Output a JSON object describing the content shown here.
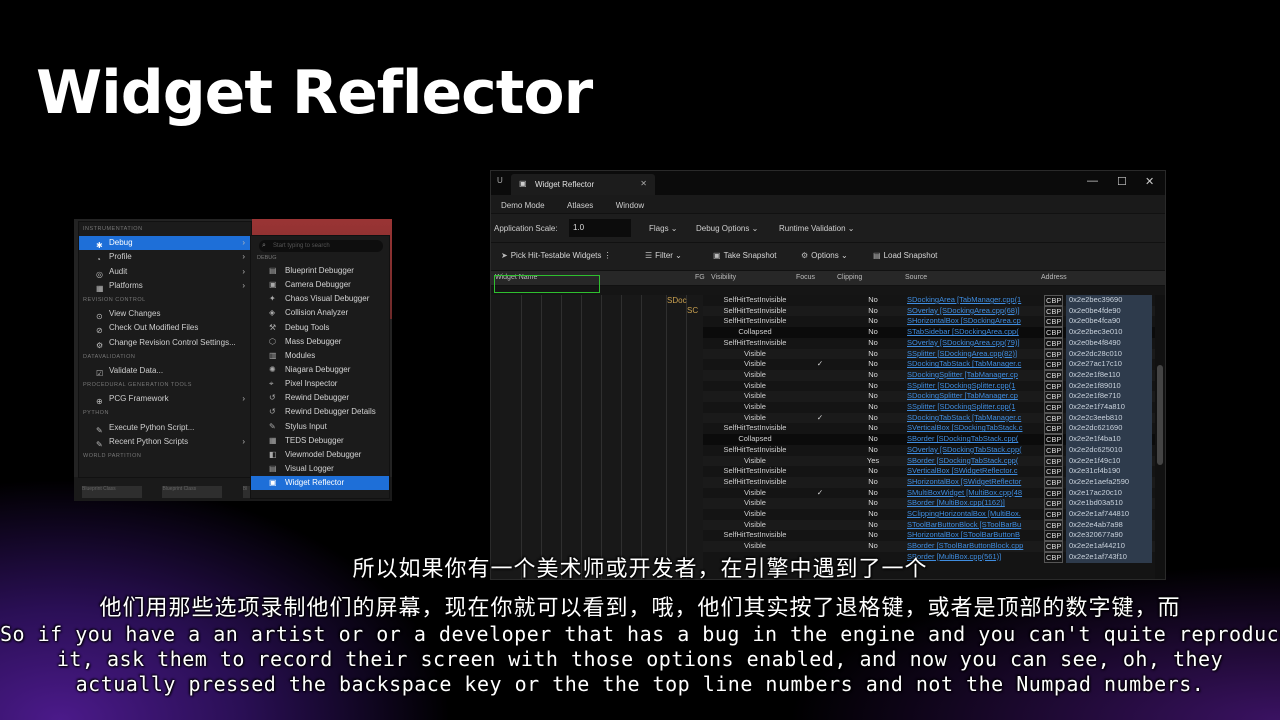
{
  "slide_title": "Widget Reflector",
  "menu": {
    "left_items": [
      {
        "type": "section",
        "label": "INSTRUMENTATION"
      },
      {
        "type": "item",
        "label": "Debug",
        "icon": "bug-icon",
        "arrow": true,
        "active": true
      },
      {
        "type": "item",
        "label": "Profile",
        "icon": "profile-icon",
        "arrow": true
      },
      {
        "type": "item",
        "label": "Audit",
        "icon": "audit-icon",
        "arrow": true
      },
      {
        "type": "item",
        "label": "Platforms",
        "icon": "platforms-icon",
        "arrow": true
      },
      {
        "type": "section",
        "label": "REVISION CONTROL"
      },
      {
        "type": "item",
        "label": "View Changes",
        "icon": "changes-icon"
      },
      {
        "type": "item",
        "label": "Check Out Modified Files",
        "icon": "checkout-icon"
      },
      {
        "type": "item",
        "label": "Change Revision Control Settings...",
        "icon": "settings-icon"
      },
      {
        "type": "section",
        "label": "DATAVALIDATION"
      },
      {
        "type": "item",
        "label": "Validate Data...",
        "icon": "validate-icon"
      },
      {
        "type": "section",
        "label": "PROCEDURAL GENERATION TOOLS"
      },
      {
        "type": "item",
        "label": "PCG Framework",
        "icon": "pcg-icon",
        "arrow": true
      },
      {
        "type": "section",
        "label": "PYTHON"
      },
      {
        "type": "item",
        "label": "Execute Python Script...",
        "icon": "python-icon"
      },
      {
        "type": "item",
        "label": "Recent Python Scripts",
        "icon": "python-icon",
        "arrow": true
      },
      {
        "type": "section",
        "label": "WORLD PARTITION"
      }
    ],
    "search_placeholder": "Start typing to search",
    "debug_section": "DEBUG",
    "sub_items": [
      {
        "label": "Blueprint Debugger",
        "icon": "blueprint-icon"
      },
      {
        "label": "Camera Debugger",
        "icon": "camera-icon"
      },
      {
        "label": "Chaos Visual Debugger",
        "icon": "chaos-icon"
      },
      {
        "label": "Collision Analyzer",
        "icon": "collision-icon"
      },
      {
        "label": "Debug Tools",
        "icon": "tools-icon"
      },
      {
        "label": "Mass Debugger",
        "icon": "mass-icon"
      },
      {
        "label": "Modules",
        "icon": "modules-icon"
      },
      {
        "label": "Niagara Debugger",
        "icon": "niagara-icon"
      },
      {
        "label": "Pixel Inspector",
        "icon": "pixel-icon"
      },
      {
        "label": "Rewind Debugger",
        "icon": "rewind-icon"
      },
      {
        "label": "Rewind Debugger Details",
        "icon": "rewind-icon"
      },
      {
        "label": "Stylus Input",
        "icon": "stylus-icon"
      },
      {
        "label": "TEDS Debugger",
        "icon": "teds-icon"
      },
      {
        "label": "Viewmodel Debugger",
        "icon": "viewmodel-icon"
      },
      {
        "label": "Visual Logger",
        "icon": "logger-icon"
      },
      {
        "label": "Widget Reflector",
        "icon": "reflector-icon",
        "active": true
      }
    ],
    "bottom_tabs": [
      "Blueprint Class",
      "Blueprint Class",
      "Bl"
    ]
  },
  "window": {
    "tab_title": "Widget Reflector",
    "menubar": [
      "Demo Mode",
      "Atlases",
      "Window"
    ],
    "app_scale_label": "Application Scale:",
    "app_scale_value": "1.0",
    "dropdowns": [
      "Flags",
      "Debug Options",
      "Runtime Validation"
    ],
    "toolbar": {
      "pick": "Pick Hit-Testable Widgets",
      "filter": "Filter",
      "snapshot": "Take Snapshot",
      "options": "Options",
      "load": "Load Snapshot"
    },
    "columns": {
      "widget_name": "Widget Name",
      "fg": "FG",
      "visibility": "Visibility",
      "focus": "Focus",
      "clipping": "Clipping",
      "source": "Source",
      "address": "Address"
    },
    "tree_labels": [
      "SDoc",
      "SC"
    ],
    "rows": [
      {
        "vis": "SelfHitTestInvisible",
        "focus": "",
        "clip": "No",
        "src": "SDockingArea [TabManager.cpp(1",
        "addr": "0x2e2bec39690"
      },
      {
        "vis": "SelfHitTestInvisible",
        "focus": "",
        "clip": "No",
        "src": "SOverlay [SDockingArea.cpp(68)]",
        "addr": "0x2e0be4fde90"
      },
      {
        "vis": "SelfHitTestInvisible",
        "focus": "",
        "clip": "No",
        "src": "SHorizontalBox [SDockingArea.cp",
        "addr": "0x2e0be4fca90"
      },
      {
        "vis": "Collapsed",
        "focus": "",
        "clip": "No",
        "src": "STabSidebar [SDockingArea.cpp(",
        "addr": "0x2e2bec3e010"
      },
      {
        "vis": "SelfHitTestInvisible",
        "focus": "",
        "clip": "No",
        "src": "SOverlay [SDockingArea.cpp(79)]",
        "addr": "0x2e0be4f8490"
      },
      {
        "vis": "Visible",
        "focus": "",
        "clip": "No",
        "src": "SSplitter [SDockingArea.cpp(82)]",
        "addr": "0x2e2dc28c010"
      },
      {
        "vis": "Visible",
        "focus": "✓",
        "clip": "No",
        "src": "SDockingTabStack [TabManager.c",
        "addr": "0x2e27ac17c10"
      },
      {
        "vis": "Visible",
        "focus": "",
        "clip": "No",
        "src": "SDockingSplitter [TabManager.cp",
        "addr": "0x2e2e1f8e110"
      },
      {
        "vis": "Visible",
        "focus": "",
        "clip": "No",
        "src": "SSplitter [SDockingSplitter.cpp(1",
        "addr": "0x2e2e1f89010"
      },
      {
        "vis": "Visible",
        "focus": "",
        "clip": "No",
        "src": "SDockingSplitter [TabManager.cp",
        "addr": "0x2e2e1f8e710"
      },
      {
        "vis": "Visible",
        "focus": "",
        "clip": "No",
        "src": "SSplitter [SDockingSplitter.cpp(1",
        "addr": "0x2e2e1f74a810"
      },
      {
        "vis": "Visible",
        "focus": "✓",
        "clip": "No",
        "src": "SDockingTabStack [TabManager.c",
        "addr": "0x2e2c3eeb810"
      },
      {
        "vis": "SelfHitTestInvisible",
        "focus": "",
        "clip": "No",
        "src": "SVerticalBox [SDockingTabStack.c",
        "addr": "0x2e2dc621690"
      },
      {
        "vis": "Collapsed",
        "focus": "",
        "clip": "No",
        "src": "SBorder [SDockingTabStack.cpp(",
        "addr": "0x2e2e1f4ba10"
      },
      {
        "vis": "SelfHitTestInvisible",
        "focus": "",
        "clip": "No",
        "src": "SOverlay [SDockingTabStack.cpp(",
        "addr": "0x2e2dc625010"
      },
      {
        "vis": "Visible",
        "focus": "",
        "clip": "Yes",
        "src": "SBorder [SDockingTabStack.cpp(",
        "addr": "0x2e2e1f49c10"
      },
      {
        "vis": "SelfHitTestInvisible",
        "focus": "",
        "clip": "No",
        "src": "SVerticalBox [SWidgetReflector.c",
        "addr": "0x2e31cf4b190"
      },
      {
        "vis": "SelfHitTestInvisible",
        "focus": "",
        "clip": "No",
        "src": "SHorizontalBox [SWidgetReflector",
        "addr": "0x2e2e1aefa2590"
      },
      {
        "vis": "Visible",
        "focus": "✓",
        "clip": "No",
        "src": "SMultiBoxWidget [MultiBox.cpp(48",
        "addr": "0x2e17ac20c10"
      },
      {
        "vis": "Visible",
        "focus": "",
        "clip": "No",
        "src": "SBorder [MultiBox.cpp(1162)]",
        "addr": "0x2e1bd03a510"
      },
      {
        "vis": "Visible",
        "focus": "",
        "clip": "No",
        "src": "SClippingHorizontalBox [MultiBox.",
        "addr": "0x2e2e1af744810"
      },
      {
        "vis": "Visible",
        "focus": "",
        "clip": "No",
        "src": "SToolBarButtonBlock [SToolBarBu",
        "addr": "0x2e2e4ab7a98"
      },
      {
        "vis": "SelfHitTestInvisible",
        "focus": "",
        "clip": "No",
        "src": "SHorizontalBox [SToolBarButtonB",
        "addr": "0x2e320677a90"
      },
      {
        "vis": "Visible",
        "focus": "",
        "clip": "No",
        "src": "SBorder [SToolBarButtonBlock.cpp",
        "addr": "0x2e2e1af44210"
      },
      {
        "vis": "",
        "focus": "",
        "clip": "",
        "src": "SBorder [MultiBox.cpp(561)]",
        "addr": "0x2e2e1af743f10"
      }
    ]
  },
  "subtitles": {
    "cn1": "所以如果你有一个美术师或开发者，在引擎中遇到了一个",
    "cn2": "他们用那些选项录制他们的屏幕，现在你就可以看到，哦，他们其实按了退格键，或者是顶部的数字键，而",
    "en1": "So if you have a an artist or or a developer that has a bug in the engine and you can't quite reproduce",
    "en2": "it, ask them to record their screen with those options enabled, and now you can see, oh, they",
    "en3": "actually pressed the backspace key or the the top line numbers and not the Numpad numbers."
  }
}
